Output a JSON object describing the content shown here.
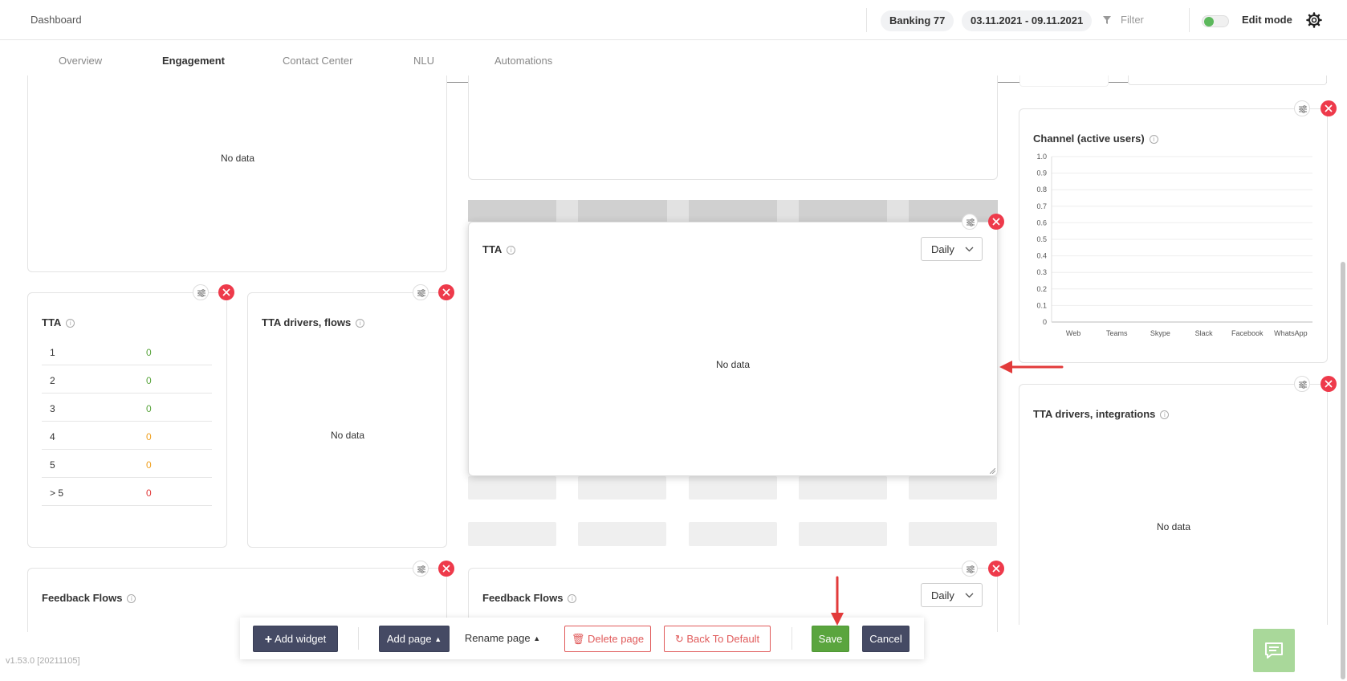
{
  "header": {
    "title": "Dashboard",
    "project": "Banking 77",
    "date_range": "03.11.2021 - 09.11.2021",
    "filter_label": "Filter",
    "edit_mode_label": "Edit mode",
    "edit_mode_on": true
  },
  "tabs": [
    {
      "label": "Overview",
      "active": false
    },
    {
      "label": "Engagement",
      "active": true
    },
    {
      "label": "Contact Center",
      "active": false
    },
    {
      "label": "NLU",
      "active": false
    },
    {
      "label": "Automations",
      "active": false
    }
  ],
  "widgets": {
    "top_left": {
      "no_data": "No data"
    },
    "tta_table": {
      "title": "TTA",
      "rows": [
        {
          "key": "1",
          "value": "0",
          "color": "#5aa53e"
        },
        {
          "key": "2",
          "value": "0",
          "color": "#5aa53e"
        },
        {
          "key": "3",
          "value": "0",
          "color": "#5aa53e"
        },
        {
          "key": "4",
          "value": "0",
          "color": "#f0a020"
        },
        {
          "key": "5",
          "value": "0",
          "color": "#f0a020"
        },
        {
          "key": "> 5",
          "value": "0",
          "color": "#e23a3a"
        }
      ]
    },
    "tta_drivers_flows": {
      "title": "TTA drivers, flows",
      "no_data": "No data"
    },
    "tta_dragging": {
      "title": "TTA",
      "select": "Daily",
      "no_data": "No data"
    },
    "channel": {
      "title": "Channel (active users)"
    },
    "tta_drivers_integrations": {
      "title": "TTA drivers, integrations",
      "no_data": "No data"
    },
    "feedback_left": {
      "title": "Feedback Flows"
    },
    "feedback_mid": {
      "title": "Feedback Flows",
      "select": "Daily"
    }
  },
  "chart_data": {
    "type": "bar",
    "title": "Channel (active users)",
    "categories": [
      "Web",
      "Teams",
      "Skype",
      "Slack",
      "Facebook",
      "WhatsApp"
    ],
    "values": [
      0,
      0,
      0,
      0,
      0,
      0
    ],
    "ylim": [
      0,
      1.0
    ],
    "yticks": [
      "1.0",
      "0.9",
      "0.8",
      "0.7",
      "0.6",
      "0.5",
      "0.4",
      "0.3",
      "0.2",
      "0.1",
      "0"
    ],
    "grid": true
  },
  "toolbar": {
    "add_widget": "Add widget",
    "add_page": "Add page",
    "rename_page": "Rename page",
    "delete_page": "Delete page",
    "back_to_default": "Back To Default",
    "save": "Save",
    "cancel": "Cancel"
  },
  "footer": {
    "version": "v1.53.0 [20211105]"
  },
  "icons": {
    "settings": "sliders-icon",
    "remove": "close-icon",
    "info": "info-icon",
    "chat": "chat-icon",
    "gear": "gear-icon",
    "filter": "funnel-icon"
  },
  "colors": {
    "accent_green": "#5aa53e",
    "danger_red": "#ee3a4b",
    "dark_button": "#454a64"
  }
}
